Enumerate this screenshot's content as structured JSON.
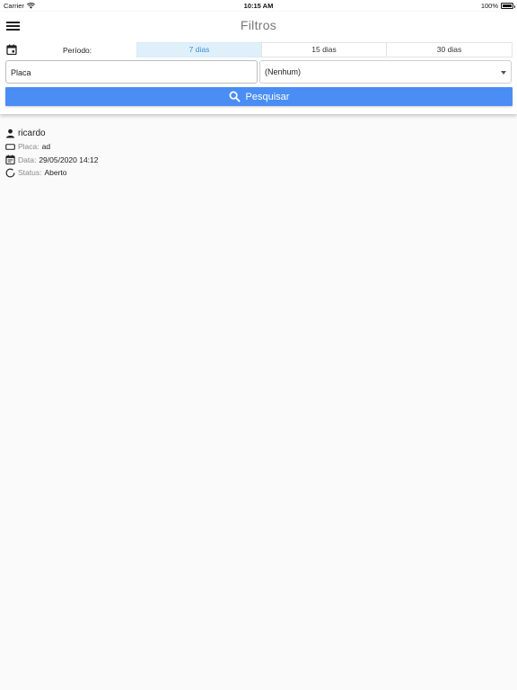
{
  "status_bar": {
    "carrier": "Carrier",
    "time": "10:15 AM",
    "battery": "100%"
  },
  "header": {
    "title": "Filtros",
    "period_label": "Período:",
    "periods": [
      {
        "label": "7 dias",
        "active": true
      },
      {
        "label": "15 dias",
        "active": false
      },
      {
        "label": "30 dias",
        "active": false
      }
    ],
    "placa_input": {
      "value": "Placa"
    },
    "status_select": {
      "value": "(Nenhum)"
    },
    "search_button": "Pesquisar"
  },
  "results": [
    {
      "name": "ricardo",
      "placa_label": "Placa:",
      "placa": "ad",
      "data_label": "Data:",
      "data": "29/05/2020 14:12",
      "status_label": "Status:",
      "status": "Aberto"
    }
  ],
  "colors": {
    "accent": "#4a8ef5",
    "active_segment_bg": "#dff0fb",
    "active_segment_text": "#3a8fd1"
  }
}
